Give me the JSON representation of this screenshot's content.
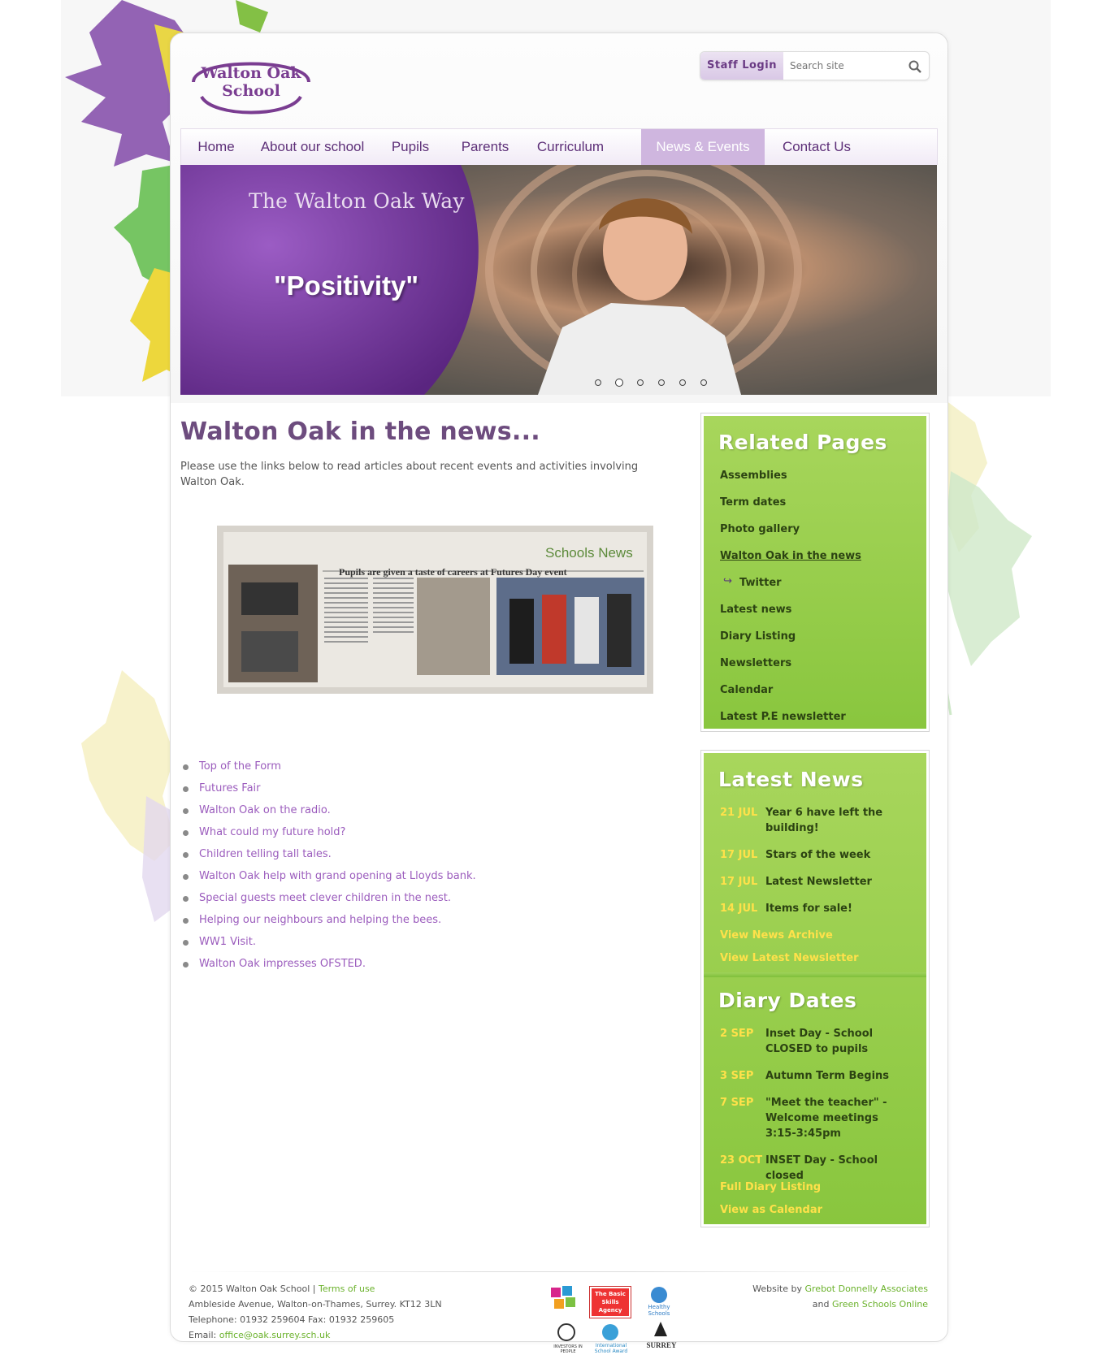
{
  "header": {
    "logo_line1": "Walton Oak",
    "logo_line2": "School",
    "staff_login": "Staff Login",
    "search_placeholder": "Search site"
  },
  "nav": {
    "items": [
      {
        "label": "Home"
      },
      {
        "label": "About our school"
      },
      {
        "label": "Pupils"
      },
      {
        "label": "Parents"
      },
      {
        "label": "Curriculum"
      },
      {
        "label": "News & Events",
        "active": true
      },
      {
        "label": "Contact Us"
      }
    ]
  },
  "banner": {
    "title": "The Walton Oak Way",
    "quote": "\"Positivity\"",
    "slide_count": 6,
    "active_slide": 2
  },
  "main": {
    "heading": "Walton Oak in the news...",
    "intro": "Please use the links below to read articles about recent events and activities involving Walton Oak.",
    "newspaper": {
      "masthead": "Schools News",
      "headline": "Pupils are given a taste of careers at Futures Day event"
    },
    "articles": [
      "Top of the Form",
      "Futures Fair",
      "Walton Oak on the radio.",
      "What could my future hold?",
      "Children telling tall tales.",
      "Walton Oak help with grand opening at Lloyds bank.",
      "Special guests meet clever children in the nest.",
      "Helping our neighbours and helping the bees.",
      "WW1 Visit.",
      "Walton Oak impresses OFSTED."
    ]
  },
  "related": {
    "title": "Related Pages",
    "items": [
      "Assemblies",
      "Term dates",
      "Photo gallery",
      "Walton Oak in the news",
      "Twitter",
      "Latest news",
      "Diary Listing",
      "Newsletters",
      "Calendar",
      "Latest P.E newsletter"
    ]
  },
  "latest_news": {
    "title": "Latest News",
    "items": [
      {
        "date": "21 JUL",
        "text": "Year 6 have left the building!"
      },
      {
        "date": "17 JUL",
        "text": "Stars of the week"
      },
      {
        "date": "17 JUL",
        "text": "Latest Newsletter"
      },
      {
        "date": "14 JUL",
        "text": "Items for sale!"
      }
    ],
    "archive_link": "View News Archive",
    "newsletter_link": "View Latest Newsletter"
  },
  "diary": {
    "title": "Diary Dates",
    "items": [
      {
        "date": "2 SEP",
        "text": "Inset Day - School CLOSED to pupils"
      },
      {
        "date": "3 SEP",
        "text": "Autumn Term Begins"
      },
      {
        "date": "7 SEP",
        "text": "\"Meet the teacher\" - Welcome meetings 3:15-3:45pm"
      },
      {
        "date": "23 OCT",
        "text": "INSET Day - School closed"
      }
    ],
    "full_link": "Full Diary Listing",
    "calendar_link": "View as Calendar"
  },
  "footer": {
    "copyright": "© 2015 Walton Oak School",
    "separator": "|",
    "terms": "Terms of use",
    "address": "Ambleside Avenue, Walton-on-Thames, Surrey. KT12 3LN",
    "phone": "Telephone: 01932 259604 Fax: 01932 259605",
    "email_label": "Email:",
    "email": "office@oak.surrey.sch.uk",
    "website_by": "Website by",
    "agency": "Grebot Donnelly Associates",
    "and": "and",
    "partner": "Green Schools Online",
    "badges": {
      "basic_skills": "The Basic Skills Agency",
      "healthy": "Healthy Schools",
      "iip": "INVESTORS IN PEOPLE",
      "isa": "International School Award",
      "surrey": "SURREY"
    }
  },
  "colors": {
    "purple": "#7a3d91",
    "nav_active": "#cfb6df",
    "green_panel": "#8cc63f",
    "date_yellow": "#ffe14a",
    "link_purple": "#9b5cbd"
  }
}
